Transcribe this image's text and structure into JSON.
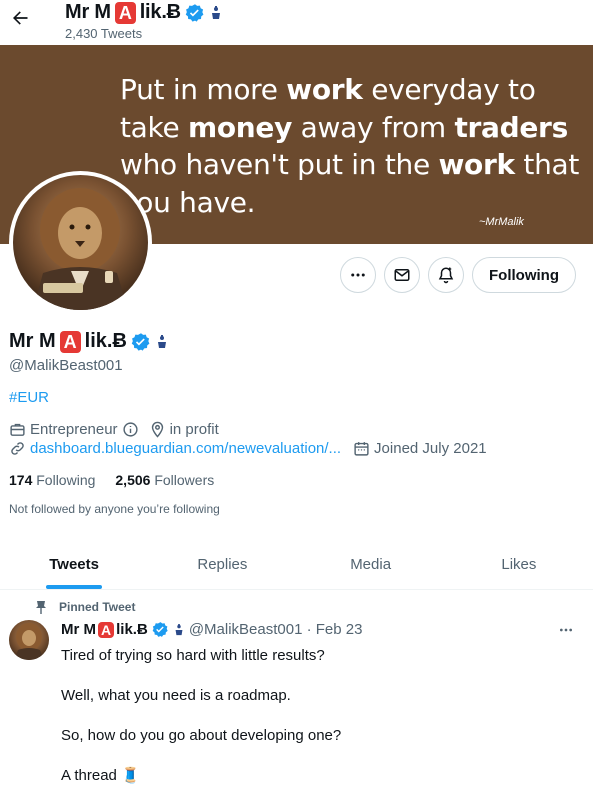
{
  "header": {
    "name_prefix": "Mr M",
    "name_a": "A",
    "name_suffix": "lik.Ƀ",
    "tweet_count": "2,430 Tweets"
  },
  "banner": {
    "quote_parts": {
      "p1": "Put in more ",
      "b1": "work",
      "p2": " everyday to take ",
      "b2": "money",
      "p3": " away from ",
      "b3": "traders",
      "p4": " who haven't put in the ",
      "b4": "work",
      "p5": " that you have."
    },
    "signature": "~MrMalik",
    "color": "#6b4a2e"
  },
  "actions": {
    "following_label": "Following"
  },
  "profile": {
    "name_prefix": "Mr M",
    "name_a": "A",
    "name_suffix": "lik.Ƀ",
    "handle": "@MalikBeast001",
    "hashtag": "#EUR",
    "category": "Entrepreneur",
    "location": "in profit",
    "website": "dashboard.blueguardian.com/newevaluation/...",
    "joined": "Joined July 2021",
    "following_count": "174",
    "following_label": "Following",
    "followers_count": "2,506",
    "followers_label": "Followers",
    "not_followed": "Not followed by anyone you’re following"
  },
  "tabs": [
    {
      "label": "Tweets"
    },
    {
      "label": "Replies"
    },
    {
      "label": "Media"
    },
    {
      "label": "Likes"
    }
  ],
  "pinned_tweet": {
    "pinned_label": "Pinned Tweet",
    "name_prefix": "Mr M",
    "name_a": "A",
    "name_suffix": "lik.Ƀ",
    "handle_date": "@MalikBeast001 · Feb 23",
    "lines": [
      "Tired of trying so hard with little results?",
      "Well, what you need is a roadmap.",
      "So, how do you go about developing one?",
      "A thread 🧵"
    ]
  },
  "colors": {
    "accent": "#1d9bf0",
    "red_badge": "#e53935",
    "muted": "#536471"
  }
}
